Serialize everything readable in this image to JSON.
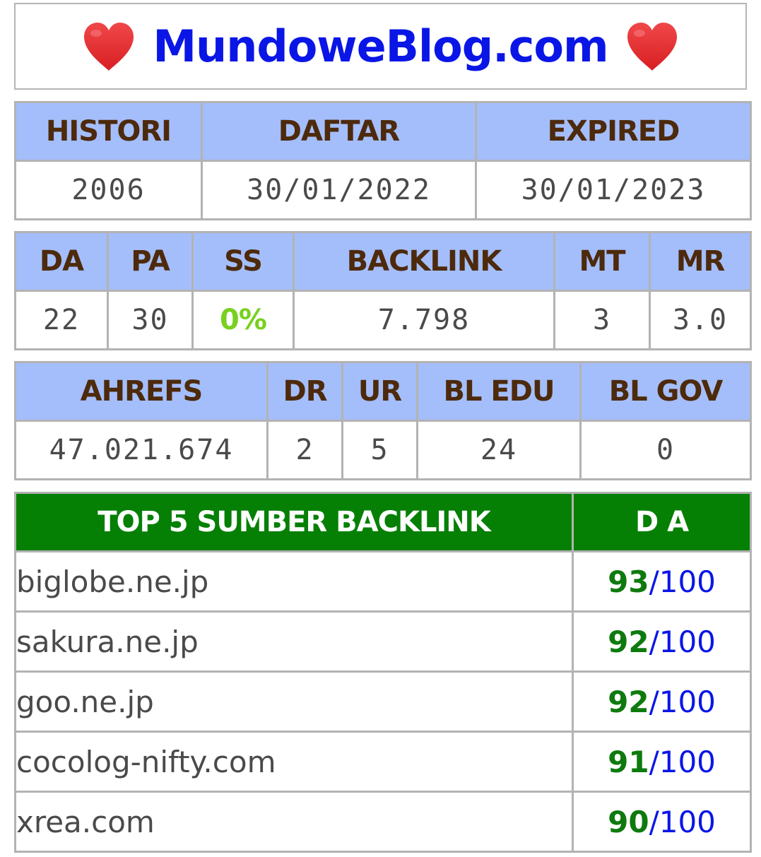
{
  "header": {
    "title": "MundoweBlog.com",
    "left_icon": "heart-icon",
    "right_icon": "heart-icon",
    "heart_color": "#e8292b"
  },
  "domain_info": {
    "headers": [
      "HISTORI",
      "DAFTAR",
      "EXPIRED"
    ],
    "values": [
      "2006",
      "30/01/2022",
      "30/01/2023"
    ]
  },
  "moz_stats": {
    "headers": [
      "DA",
      "PA",
      "SS",
      "BACKLINK",
      "MT",
      "MR"
    ],
    "values": [
      "22",
      "30",
      "0%",
      "7.798",
      "3",
      "3.0"
    ]
  },
  "ahrefs_stats": {
    "headers": [
      "AHREFS",
      "DR",
      "UR",
      "BL EDU",
      "BL GOV"
    ],
    "values": [
      "47.021.674",
      "2",
      "5",
      "24",
      "0"
    ]
  },
  "top_backlinks": {
    "headers": [
      "TOP 5 SUMBER BACKLINK",
      "D A"
    ],
    "separator": "/",
    "max": "100",
    "rows": [
      {
        "domain": "biglobe.ne.jp",
        "da": "93"
      },
      {
        "domain": "sakura.ne.jp",
        "da": "92"
      },
      {
        "domain": "goo.ne.jp",
        "da": "92"
      },
      {
        "domain": "cocolog-nifty.com",
        "da": "91"
      },
      {
        "domain": "xrea.com",
        "da": "90"
      }
    ]
  },
  "colors": {
    "header_bg": "#a4befb",
    "header_text": "#4d2a0c",
    "top_header_bg": "#058005",
    "title_blue": "#0a16e6",
    "ss_green": "#77d11e",
    "score_green": "#0e7a0e"
  }
}
